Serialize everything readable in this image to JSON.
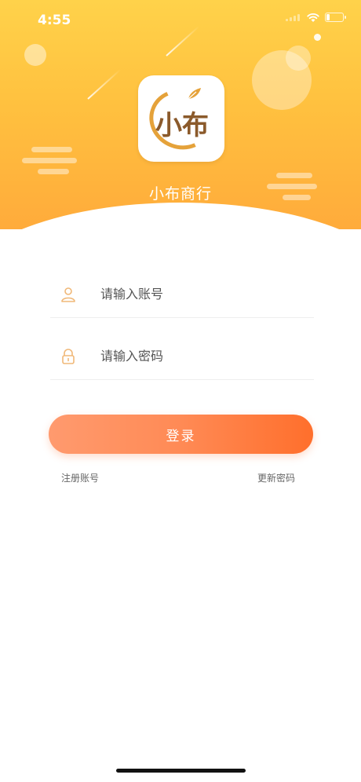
{
  "status_bar": {
    "time": "4:55"
  },
  "app": {
    "name": "小布商行",
    "logo_text": "小布"
  },
  "form": {
    "account_placeholder": "请输入账号",
    "password_placeholder": "请输入密码",
    "login_label": "登录"
  },
  "links": {
    "register": "注册账号",
    "reset_password": "更新密码"
  },
  "colors": {
    "header_top": "#ffd24a",
    "header_bottom": "#ffab3b",
    "button_start": "#ff9a6e",
    "button_end": "#ff6f2c",
    "icon_accent": "#f0b878"
  },
  "icons": {
    "account": "user-icon",
    "password": "lock-icon",
    "wifi": "wifi-icon",
    "battery": "battery-icon"
  }
}
